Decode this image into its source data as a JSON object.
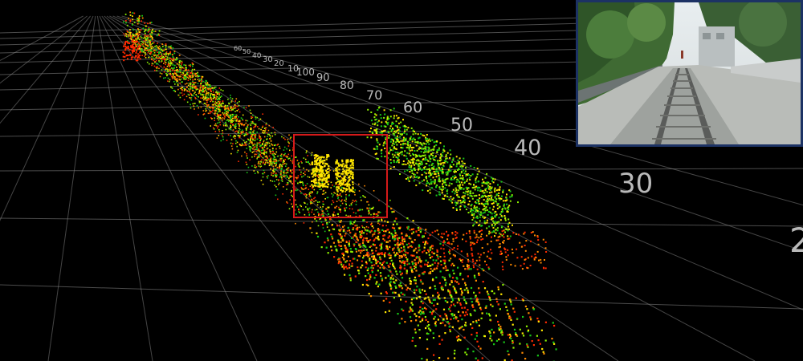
{
  "viewer": {
    "background": "#000000",
    "grid_color": "#8a8a8a",
    "detection_box_color": "#d41a1a",
    "point_cloud_colormap": [
      "#ff2a00",
      "#ff8a00",
      "#ffe600",
      "#8cf000",
      "#18c818"
    ]
  },
  "distance_labels": [
    "30",
    "40",
    "50",
    "60",
    "70",
    "80",
    "90",
    "100",
    "10",
    "20",
    "30",
    "40",
    "50",
    "60",
    "2"
  ],
  "camera_inset": {
    "frame_color": "#1c3264"
  }
}
